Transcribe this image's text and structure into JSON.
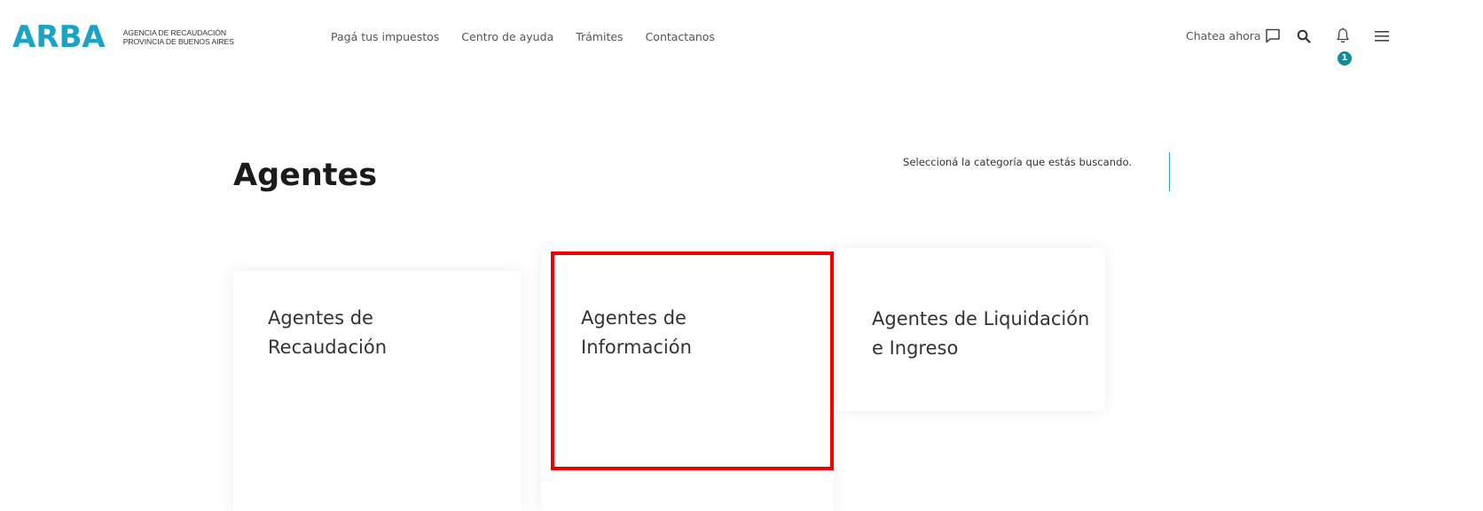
{
  "header": {
    "logo": "ARBA",
    "logo_sub_line1": "AGENCIA DE RECAUDACIÓN",
    "logo_sub_line2": "PROVINCIA DE BUENOS AIRES",
    "nav": [
      {
        "label": "Pagá tus impuestos"
      },
      {
        "label": "Centro de ayuda"
      },
      {
        "label": "Trámites"
      },
      {
        "label": "Contactanos"
      }
    ],
    "chat_label": "Chatea ahora",
    "notification_count": "1",
    "icons": [
      "chat-icon",
      "search-icon",
      "bell-icon",
      "hamburger-menu-icon"
    ]
  },
  "main": {
    "title": "Agentes",
    "subtitle": "Seleccioná la categoría que estás buscando.",
    "cards": [
      {
        "line1": "Agentes de",
        "line2": "Recaudación"
      },
      {
        "line1": "Agentes de",
        "line2": "Información"
      },
      {
        "line1": "Agentes de Liquidación",
        "line2": "e Ingreso"
      }
    ]
  },
  "colors": {
    "brand": "#1aa3c4",
    "accent": "#128c9c",
    "highlight": "#f00000"
  }
}
